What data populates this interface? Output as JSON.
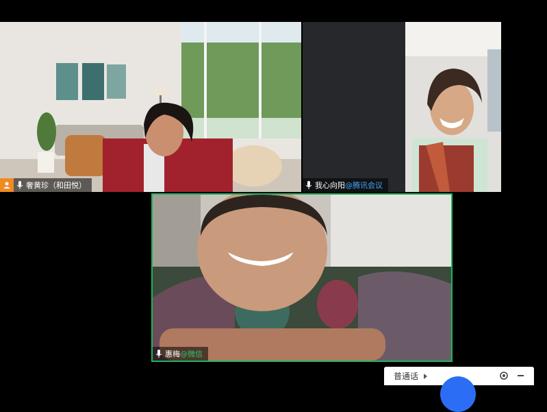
{
  "participants": [
    {
      "name": "奢黄珍（和田悦）",
      "suffix": "",
      "host": true,
      "icons": [
        "host-icon",
        "microphone-icon"
      ]
    },
    {
      "name": "我心向阳",
      "suffix": "@腾讯会议",
      "host": false,
      "icons": [
        "microphone-icon"
      ]
    },
    {
      "name": "惠梅",
      "suffix": "@微信",
      "host": false,
      "active_speaker": true,
      "icons": [
        "microphone-icon"
      ]
    }
  ],
  "language_bar": {
    "label": "普通话",
    "icons": [
      "expand-arrow-icon",
      "settings-icon",
      "minimize-icon"
    ]
  },
  "colors": {
    "active_speaker_border": "#1fb45c",
    "host_badge": "#f08a24",
    "tencent_suffix": "#3ea8ff",
    "wechat_suffix": "#2bc36b"
  }
}
